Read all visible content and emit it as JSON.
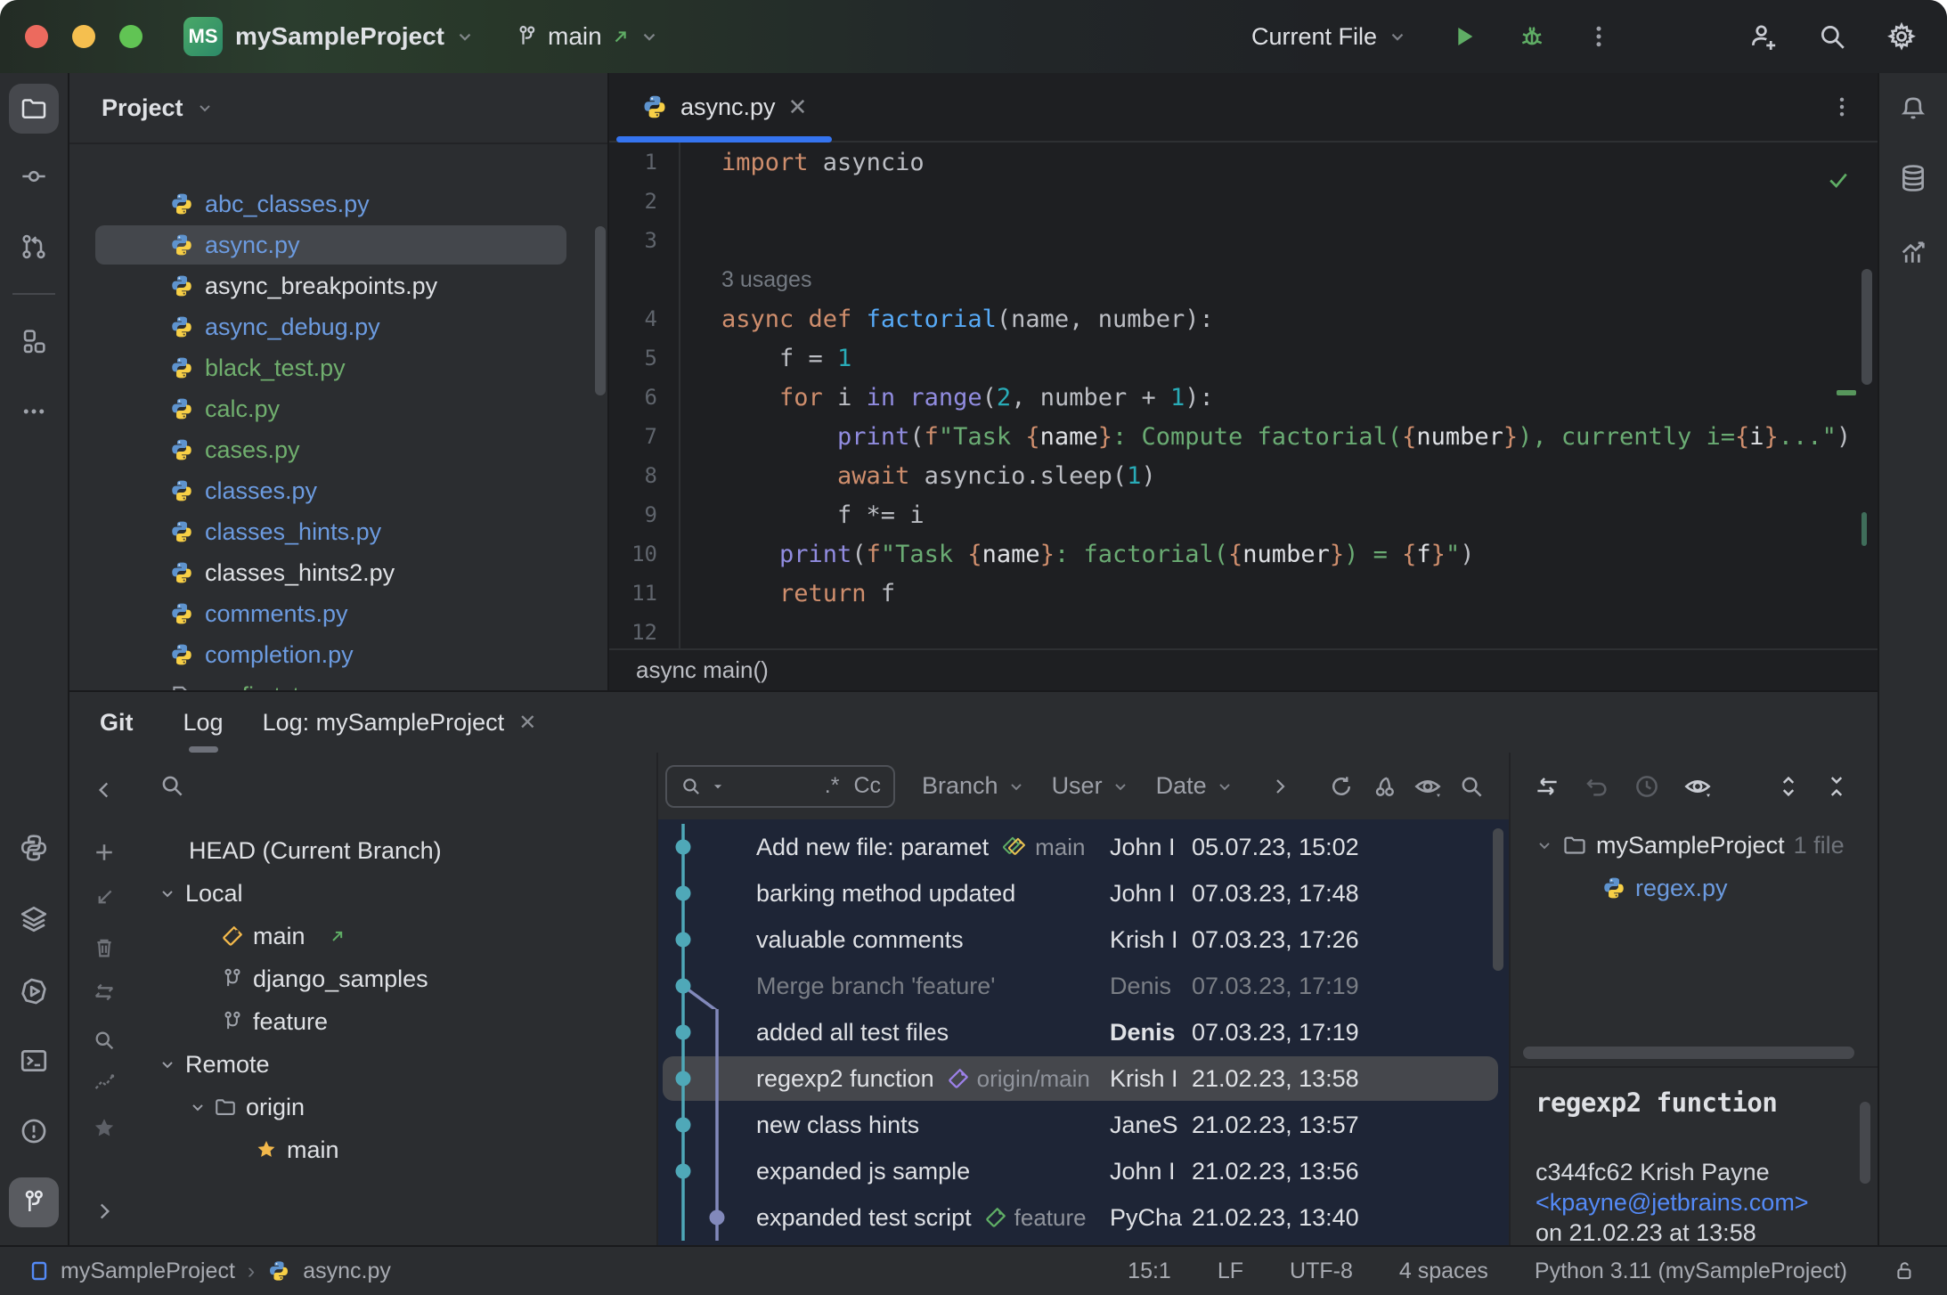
{
  "colors": {
    "accent_blue": "#3574f0",
    "run_green": "#5fad65",
    "file_modified_blue": "#6c9be0",
    "file_added_green": "#70af6e",
    "graph_teal": "#4fa8b8",
    "graph_purple": "#8289bb",
    "tag_yellow": "#f2b84b",
    "traffic": [
      "#ec6a5e",
      "#f5bf4f",
      "#61c454"
    ]
  },
  "titlebar": {
    "project_badge": "MS",
    "project_name": "mySampleProject",
    "branch_name": "main",
    "run_config": "Current File"
  },
  "project_panel": {
    "title": "Project",
    "files": [
      {
        "name": "abc_classes.py",
        "icon": "python",
        "color": "blue"
      },
      {
        "name": "async.py",
        "icon": "python",
        "color": "blue",
        "selected": true
      },
      {
        "name": "async_breakpoints.py",
        "icon": "python",
        "color": "white"
      },
      {
        "name": "async_debug.py",
        "icon": "python",
        "color": "blue"
      },
      {
        "name": "black_test.py",
        "icon": "python",
        "color": "green"
      },
      {
        "name": "calc.py",
        "icon": "python",
        "color": "green"
      },
      {
        "name": "cases.py",
        "icon": "python",
        "color": "green"
      },
      {
        "name": "classes.py",
        "icon": "python",
        "color": "blue"
      },
      {
        "name": "classes_hints.py",
        "icon": "python",
        "color": "blue"
      },
      {
        "name": "classes_hints2.py",
        "icon": "python",
        "color": "white"
      },
      {
        "name": "comments.py",
        "icon": "python",
        "color": "blue"
      },
      {
        "name": "completion.py",
        "icon": "python",
        "color": "blue"
      },
      {
        "name": "config.txt",
        "icon": "text",
        "color": "green"
      }
    ]
  },
  "editor": {
    "tab_name": "async.py",
    "sticky_line": "async main()",
    "code": [
      {
        "n": "1",
        "seg": [
          [
            "k",
            "import"
          ],
          [
            "p",
            " asyncio"
          ]
        ]
      },
      {
        "n": "2",
        "seg": []
      },
      {
        "n": "3",
        "seg": []
      },
      {
        "inlay": "3 usages"
      },
      {
        "n": "4",
        "seg": [
          [
            "k",
            "async"
          ],
          [
            "p",
            " "
          ],
          [
            "k",
            "def"
          ],
          [
            "p",
            " "
          ],
          [
            "fn",
            "factorial"
          ],
          [
            "p",
            "(name, number):"
          ]
        ]
      },
      {
        "n": "5",
        "seg": [
          [
            "p",
            "    f = "
          ],
          [
            "num",
            "1"
          ]
        ]
      },
      {
        "n": "6",
        "seg": [
          [
            "p",
            "    "
          ],
          [
            "k",
            "for"
          ],
          [
            "p",
            " i "
          ],
          [
            "bi",
            "in"
          ],
          [
            "p",
            " "
          ],
          [
            "bi",
            "range"
          ],
          [
            "p",
            "("
          ],
          [
            "num",
            "2"
          ],
          [
            "p",
            ", number + "
          ],
          [
            "num",
            "1"
          ],
          [
            "p",
            "):"
          ]
        ]
      },
      {
        "n": "7",
        "seg": [
          [
            "p",
            "        "
          ],
          [
            "bi",
            "print"
          ],
          [
            "p",
            "("
          ],
          [
            "k",
            "f"
          ],
          [
            "str",
            "\"Task "
          ],
          [
            "br",
            "{"
          ],
          [
            "v",
            "name"
          ],
          [
            "br",
            "}"
          ],
          [
            "str",
            ": Compute factorial("
          ],
          [
            "br",
            "{"
          ],
          [
            "v",
            "number"
          ],
          [
            "br",
            "}"
          ],
          [
            "str",
            "), currently i="
          ],
          [
            "br",
            "{"
          ],
          [
            "v",
            "i"
          ],
          [
            "br",
            "}"
          ],
          [
            "str",
            "...\""
          ],
          [
            "p",
            ")"
          ]
        ]
      },
      {
        "n": "8",
        "seg": [
          [
            "p",
            "        "
          ],
          [
            "k",
            "await"
          ],
          [
            "p",
            " asyncio.sleep("
          ],
          [
            "num",
            "1"
          ],
          [
            "p",
            ")"
          ]
        ]
      },
      {
        "n": "9",
        "seg": [
          [
            "p",
            "        f *= i"
          ]
        ]
      },
      {
        "n": "10",
        "seg": [
          [
            "p",
            "    "
          ],
          [
            "bi",
            "print"
          ],
          [
            "p",
            "("
          ],
          [
            "k",
            "f"
          ],
          [
            "str",
            "\"Task "
          ],
          [
            "br",
            "{"
          ],
          [
            "v",
            "name"
          ],
          [
            "br",
            "}"
          ],
          [
            "str",
            ": factorial("
          ],
          [
            "br",
            "{"
          ],
          [
            "v",
            "number"
          ],
          [
            "br",
            "}"
          ],
          [
            "str",
            ") = "
          ],
          [
            "br",
            "{"
          ],
          [
            "v",
            "f"
          ],
          [
            "br",
            "}"
          ],
          [
            "str",
            "\""
          ],
          [
            "p",
            ")"
          ]
        ]
      },
      {
        "n": "11",
        "seg": [
          [
            "p",
            "    "
          ],
          [
            "k",
            "return"
          ],
          [
            "p",
            " f"
          ]
        ]
      },
      {
        "n": "12",
        "seg": []
      }
    ]
  },
  "git": {
    "window_title": "Git",
    "tab_log": "Log",
    "tab_log_project": "Log: mySampleProject",
    "toolbar": {
      "regex_toggle": ".*",
      "case_toggle": "Cc",
      "filter_branch": "Branch",
      "filter_user": "User",
      "filter_date": "Date"
    },
    "branches": [
      {
        "label": "HEAD (Current Branch)",
        "ind": "head"
      },
      {
        "label": "Local",
        "ind": "grp",
        "chevron": true
      },
      {
        "label": "main",
        "ind": "b1",
        "icon": "tag",
        "arrow": true
      },
      {
        "label": "django_samples",
        "ind": "b1",
        "icon": "branch"
      },
      {
        "label": "feature",
        "ind": "b1",
        "icon": "branch"
      },
      {
        "label": "Remote",
        "ind": "grp",
        "chevron": true
      },
      {
        "label": "origin",
        "ind": "origin",
        "chevron": true,
        "icon": "folder"
      },
      {
        "label": "main",
        "ind": "b2",
        "icon": "star"
      }
    ],
    "commits": [
      {
        "msg": "Add new file: paramet",
        "ref": "main",
        "reficon": "tags",
        "author": "John I",
        "date": "05.07.23, 15:02",
        "graph": "d1"
      },
      {
        "msg": "barking method updated",
        "author": "John I",
        "date": "07.03.23, 17:48",
        "graph": "d1"
      },
      {
        "msg": "valuable comments",
        "author": "Krish I",
        "date": "07.03.23, 17:26",
        "graph": "d1"
      },
      {
        "msg": "Merge branch 'feature'",
        "author": "Denis",
        "date": "07.03.23, 17:19",
        "graph": "merge",
        "muted": true
      },
      {
        "msg": "added all test files",
        "author": "Denis",
        "date": "07.03.23, 17:19",
        "graph": "d1c2",
        "bold": true
      },
      {
        "msg": "regexp2 function",
        "ref": "origin/main",
        "reficon": "tag-purple",
        "author": "Krish I",
        "date": "21.02.23, 13:58",
        "graph": "d1c2",
        "selected": true
      },
      {
        "msg": "new class hints",
        "author": "JaneS",
        "date": "21.02.23, 13:57",
        "graph": "d1c2"
      },
      {
        "msg": "expanded js sample",
        "author": "John I",
        "date": "21.02.23, 13:56",
        "graph": "d1c2"
      },
      {
        "msg": "expanded test script",
        "ref": "feature",
        "reficon": "tag-green",
        "author": "PyCha",
        "date": "21.02.23, 13:40",
        "graph": "c1d2"
      }
    ],
    "changes": {
      "root": "mySampleProject",
      "count": "1 file",
      "file": "regex.py"
    },
    "details": {
      "title": "regexp2 function",
      "meta": "c344fc62 Krish Payne",
      "email": "<kpayne@jetbrains.com>",
      "when": "on 21.02.23 at 13:58"
    }
  },
  "statusbar": {
    "project": "mySampleProject",
    "file": "async.py",
    "items": [
      "15:1",
      "LF",
      "UTF-8",
      "4 spaces",
      "Python 3.11 (mySampleProject)"
    ]
  }
}
